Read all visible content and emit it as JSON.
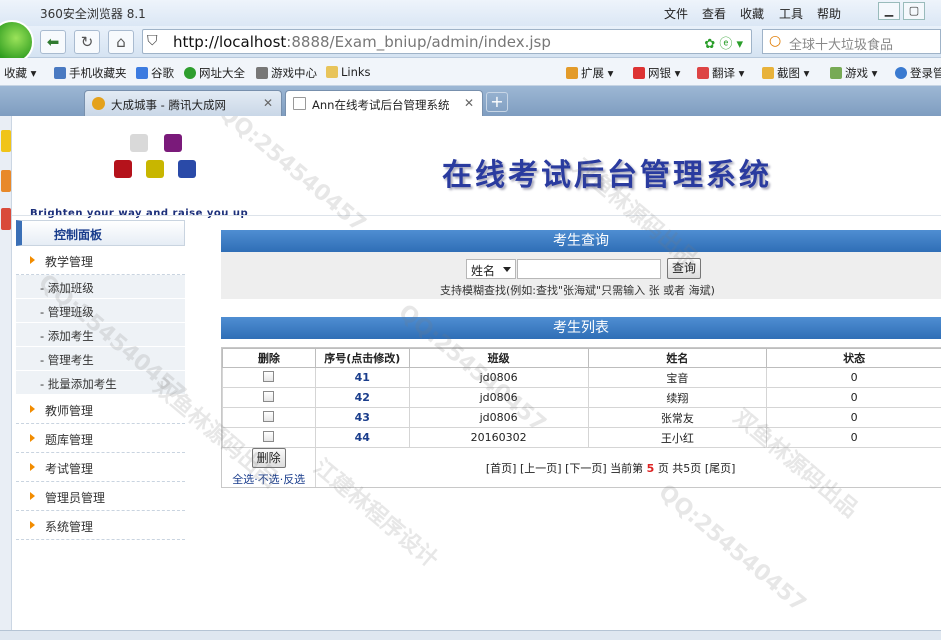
{
  "browser": {
    "app_title": "360安全浏览器 8.1",
    "menus": [
      "文件",
      "查看",
      "收藏",
      "工具",
      "帮助"
    ],
    "url_host": "http://localhost",
    "url_rest": ":8888/Exam_bniup/admin/index.jsp",
    "search_placeholder": "全球十大垃圾食品",
    "bookmarks": [
      "收藏",
      "手机收藏夹",
      "谷歌",
      "网址大全",
      "游戏中心",
      "Links"
    ],
    "toolbar_items": [
      "扩展",
      "网银",
      "翻译",
      "截图",
      "游戏",
      "登录管"
    ],
    "tabs": [
      {
        "label": "大成城事 - 腾讯大成网",
        "active": false
      },
      {
        "label": "Ann在线考试后台管理系统",
        "active": true
      }
    ]
  },
  "header": {
    "tagline": "Brighten your way and raise you up",
    "system_title": "在线考试后台管理系统"
  },
  "sidebar": {
    "panel_title": "控制面板",
    "group_teaching": "教学管理",
    "sub_items": [
      "- 添加班级",
      "- 管理班级",
      "- 添加考生",
      "- 管理考生",
      "- 批量添加考生"
    ],
    "groups": [
      "教师管理",
      "题库管理",
      "考试管理",
      "管理员管理",
      "系统管理"
    ]
  },
  "query": {
    "title": "考生查询",
    "field_selected": "姓名",
    "button": "查询",
    "hint": "支持模糊查找(例如:查找\"张海斌\"只需输入 张  或者 海斌)"
  },
  "list": {
    "title": "考生列表",
    "columns": [
      "删除",
      "序号(点击修改)",
      "班级",
      "姓名",
      "状态"
    ],
    "rows": [
      {
        "id": "41",
        "class": "jd0806",
        "name": "宝音",
        "status": "0"
      },
      {
        "id": "42",
        "class": "jd0806",
        "name": "续翔",
        "status": "0"
      },
      {
        "id": "43",
        "class": "jd0806",
        "name": "张常友",
        "status": "0"
      },
      {
        "id": "44",
        "class": "20160302",
        "name": "王小红",
        "status": "0"
      }
    ],
    "delete_button": "删除",
    "select_all": "全选",
    "select_none": "不选",
    "select_invert": "反选",
    "pager": {
      "first": "[首页]",
      "prev": "[上一页]",
      "next": "[下一页]",
      "current_prefix": "当前第",
      "current_page": "5",
      "total_label": "页 共5页",
      "last": "[尾页]"
    }
  },
  "watermark": {
    "text1": "QQ:254540457",
    "text2": "双鱼林源码出品",
    "text3": "江建林程序设计"
  },
  "colors": {
    "bar_blue": "#2f6eb6",
    "title_blue": "#2a3b9f",
    "accent_orange": "#f28c00"
  }
}
